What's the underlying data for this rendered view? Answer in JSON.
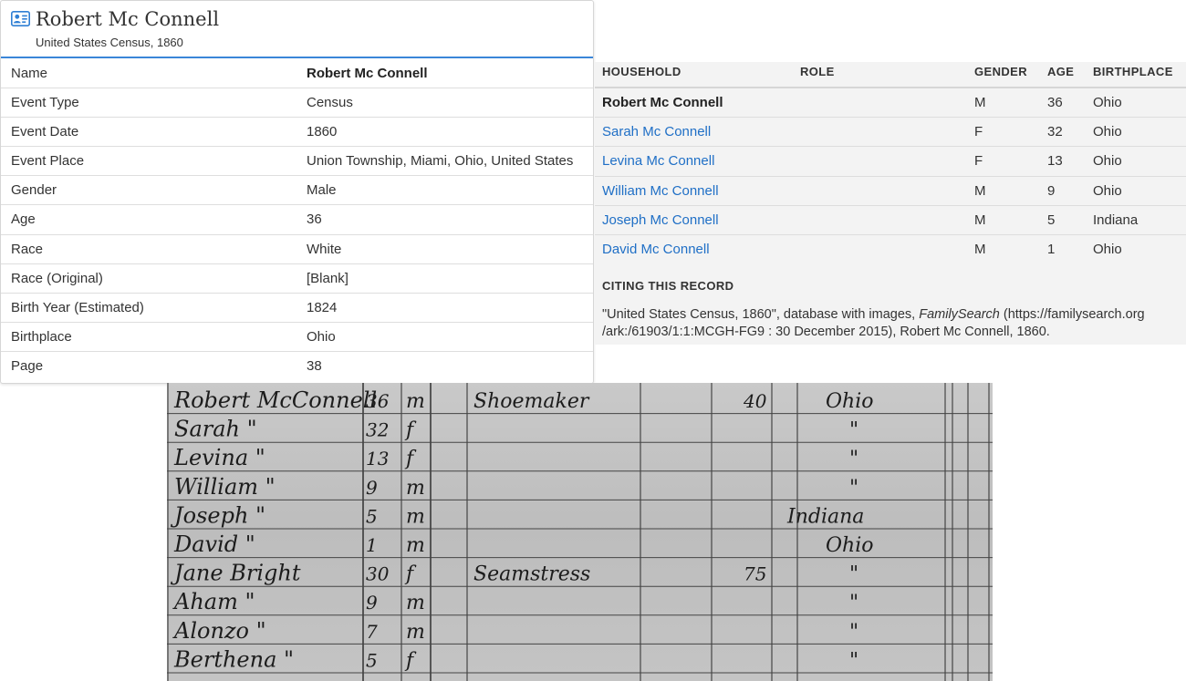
{
  "record": {
    "title": "Robert Mc Connell",
    "subtitle": "United States Census, 1860",
    "facts": [
      {
        "label": "Name",
        "value": "Robert Mc Connell"
      },
      {
        "label": "Event Type",
        "value": "Census"
      },
      {
        "label": "Event Date",
        "value": "1860"
      },
      {
        "label": "Event Place",
        "value": "Union Township, Miami, Ohio, United States"
      },
      {
        "label": "Gender",
        "value": "Male"
      },
      {
        "label": "Age",
        "value": "36"
      },
      {
        "label": "Race",
        "value": "White"
      },
      {
        "label": "Race (Original)",
        "value": "[Blank]"
      },
      {
        "label": "Birth Year (Estimated)",
        "value": "1824"
      },
      {
        "label": "Birthplace",
        "value": "Ohio"
      },
      {
        "label": "Page",
        "value": "38"
      }
    ]
  },
  "household": {
    "headers": {
      "household": "HOUSEHOLD",
      "role": "ROLE",
      "gender": "GENDER",
      "age": "AGE",
      "birthplace": "BIRTHPLACE"
    },
    "members": [
      {
        "name": "Robert Mc Connell",
        "role": "",
        "gender": "M",
        "age": "36",
        "birthplace": "Ohio"
      },
      {
        "name": "Sarah Mc Connell",
        "role": "",
        "gender": "F",
        "age": "32",
        "birthplace": "Ohio"
      },
      {
        "name": "Levina Mc Connell",
        "role": "",
        "gender": "F",
        "age": "13",
        "birthplace": "Ohio"
      },
      {
        "name": "William Mc Connell",
        "role": "",
        "gender": "M",
        "age": "9",
        "birthplace": "Ohio"
      },
      {
        "name": "Joseph Mc Connell",
        "role": "",
        "gender": "M",
        "age": "5",
        "birthplace": "Indiana"
      },
      {
        "name": "David Mc Connell",
        "role": "",
        "gender": "M",
        "age": "1",
        "birthplace": "Ohio"
      }
    ]
  },
  "citation": {
    "heading": "CITING THIS RECORD",
    "line1_pre": "\"United States Census, 1860\", database with images, ",
    "line1_em": "FamilySearch",
    "line1_post": " (https://familysearch.org",
    "line2": "/ark:/61903/1:1:MCGH-FG9 : 30 December 2015), Robert Mc Connell, 1860."
  },
  "scan": {
    "rows": [
      {
        "name": "Robert McConnell",
        "age": "36",
        "sex": "m",
        "occupation": "Shoemaker",
        "value": "40",
        "birthplace": "Ohio"
      },
      {
        "name": "Sarah \"",
        "age": "32",
        "sex": "f",
        "occupation": "",
        "value": "",
        "birthplace": "\""
      },
      {
        "name": "Levina \"",
        "age": "13",
        "sex": "f",
        "occupation": "",
        "value": "",
        "birthplace": "\""
      },
      {
        "name": "William \"",
        "age": "9",
        "sex": "m",
        "occupation": "",
        "value": "",
        "birthplace": "\""
      },
      {
        "name": "Joseph \"",
        "age": "5",
        "sex": "m",
        "occupation": "",
        "value": "",
        "birthplace": "Indiana"
      },
      {
        "name": "David \"",
        "age": "1",
        "sex": "m",
        "occupation": "",
        "value": "",
        "birthplace": "Ohio"
      },
      {
        "name": "Jane Bright",
        "age": "30",
        "sex": "f",
        "occupation": "Seamstress",
        "value": "75",
        "birthplace": "\""
      },
      {
        "name": "Aham \"",
        "age": "9",
        "sex": "m",
        "occupation": "",
        "value": "",
        "birthplace": "\""
      },
      {
        "name": "Alonzo \"",
        "age": "7",
        "sex": "m",
        "occupation": "",
        "value": "",
        "birthplace": "\""
      },
      {
        "name": "Berthena \"",
        "age": "5",
        "sex": "f",
        "occupation": "",
        "value": "",
        "birthplace": "\""
      }
    ]
  },
  "colors": {
    "link": "#1f6fc6",
    "accent": "#3a86d8",
    "panel_bg": "#f3f3f3"
  },
  "icons": {
    "record": "person-card-icon"
  }
}
